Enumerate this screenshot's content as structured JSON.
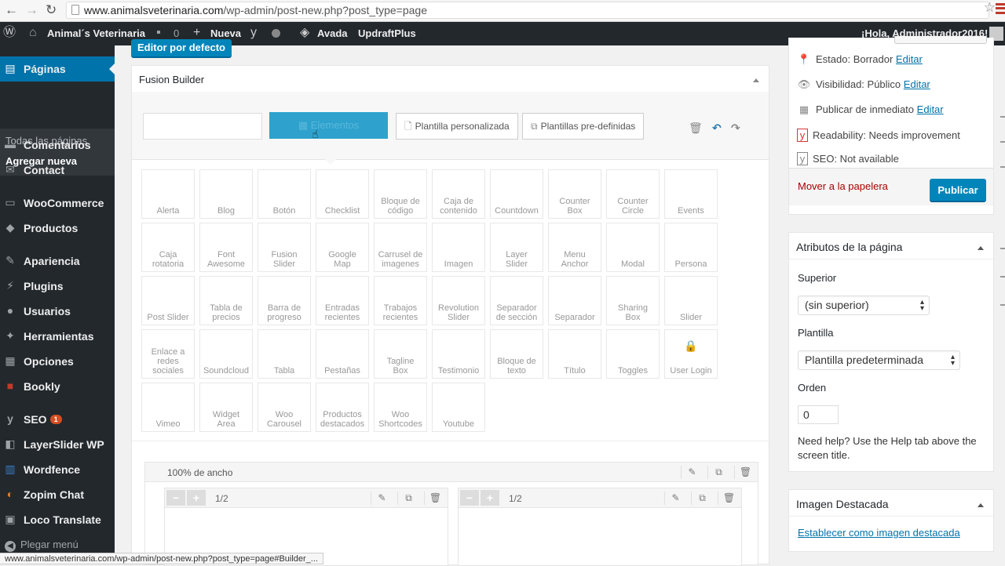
{
  "browser": {
    "url_host": "www.animalsveterinaria.com",
    "url_path": "/wp-admin/post-new.php?post_type=page"
  },
  "adminbar": {
    "site_name": "Animal´s Veterinaria",
    "comments_count": "0",
    "new_label": "Nueva",
    "avada_label": "Avada",
    "updraft_label": "UpdraftPlus",
    "greeting": "¡Hola, Administrador2016!"
  },
  "sidebar": {
    "items": [
      {
        "label": "Páginas",
        "icon": "pages-icon"
      },
      {
        "label": "Comentarios",
        "icon": "comments-icon"
      },
      {
        "label": "Contact",
        "icon": "mail-icon"
      },
      {
        "label": "WooCommerce",
        "icon": "woo-icon"
      },
      {
        "label": "Productos",
        "icon": "box-icon"
      },
      {
        "label": "Apariencia",
        "icon": "brush-icon"
      },
      {
        "label": "Plugins",
        "icon": "plug-icon"
      },
      {
        "label": "Usuarios",
        "icon": "user-icon"
      },
      {
        "label": "Herramientas",
        "icon": "wrench-icon"
      },
      {
        "label": "Opciones",
        "icon": "sliders-icon"
      },
      {
        "label": "Bookly",
        "icon": "bookly-icon"
      },
      {
        "label": "SEO",
        "icon": "seo-icon",
        "badge": "1"
      },
      {
        "label": "LayerSlider WP",
        "icon": "layers-icon"
      },
      {
        "label": "Wordfence",
        "icon": "wordfence-icon"
      },
      {
        "label": "Zopim Chat",
        "icon": "chat-icon"
      },
      {
        "label": "Loco Translate",
        "icon": "translate-icon"
      }
    ],
    "sub": [
      "Todas las páginas",
      "Agregar nueva"
    ],
    "collapse": "Plegar menú"
  },
  "editor_button": "Editor por defecto",
  "fusion": {
    "title": "Fusion Builder",
    "elements_btn": "Elementos",
    "custom_tpl": "Plantilla personalizada",
    "predef_tpl": "Plantillas pre-definidas",
    "elements": [
      [
        "Alerta"
      ],
      [
        "Blog"
      ],
      [
        "Botón"
      ],
      [
        "Checklist"
      ],
      [
        "Bloque de",
        "código"
      ],
      [
        "Caja de",
        "contenido"
      ],
      [
        "Countdown"
      ],
      [
        "Counter",
        "Box"
      ],
      [
        "Counter",
        "Circle"
      ],
      [
        "Events"
      ],
      [
        "Caja",
        "rotatoria"
      ],
      [
        "Font",
        "Awesome"
      ],
      [
        "Fusion",
        "Slider"
      ],
      [
        "Google",
        "Map"
      ],
      [
        "Carrusel de",
        "imagenes"
      ],
      [
        "Imagen"
      ],
      [
        "Layer",
        "Slider"
      ],
      [
        "Menu",
        "Anchor"
      ],
      [
        "Modal"
      ],
      [
        "Persona"
      ],
      [
        "Post Slider"
      ],
      [
        "Tabla de",
        "precios"
      ],
      [
        "Barra de",
        "progreso"
      ],
      [
        "Entradas",
        "recientes"
      ],
      [
        "Trabajos",
        "recientes"
      ],
      [
        "Revolution",
        "Slider"
      ],
      [
        "Separador",
        "de sección"
      ],
      [
        "Separador"
      ],
      [
        "Sharing",
        "Box"
      ],
      [
        "Slider"
      ],
      [
        "Enlace a",
        "redes",
        "sociales"
      ],
      [
        "Soundcloud"
      ],
      [
        "Tabla"
      ],
      [
        "Pestañas"
      ],
      [
        "Tagline",
        "Box"
      ],
      [
        "Testimonio"
      ],
      [
        "Bloque de",
        "texto"
      ],
      [
        "Título"
      ],
      [
        "Toggles"
      ],
      [
        "User Login"
      ],
      [
        "Vimeo"
      ],
      [
        "Widget",
        "Area"
      ],
      [
        "Woo",
        "Carousel"
      ],
      [
        "Productos",
        "destacados"
      ],
      [
        "Woo",
        "Shortcodes"
      ],
      [
        "Youtube"
      ]
    ],
    "container_title": "100% de ancho",
    "column_size": "1/2"
  },
  "publish": {
    "status_label": "Estado: Borrador",
    "status_edit": "Editar",
    "visibility_label": "Visibilidad: Público",
    "visibility_edit": "Editar",
    "schedule_label": "Publicar de inmediato",
    "schedule_edit": "Editar",
    "readability": "Readability: Needs improvement",
    "seo": "SEO: Not available",
    "trash": "Mover a la papelera",
    "publish_btn": "Publicar"
  },
  "attributes": {
    "title": "Atributos de la página",
    "parent_label": "Superior",
    "parent_value": "(sin superior)",
    "template_label": "Plantilla",
    "template_value": "Plantilla predeterminada",
    "order_label": "Orden",
    "order_value": "0",
    "help": "Need help? Use the Help tab above the screen title."
  },
  "featured": {
    "title": "Imagen Destacada",
    "link": "Establecer como imagen destacada"
  },
  "status_bar": "www.animalsveterinaria.com/wp-admin/post-new.php?post_type=page#Builder_..."
}
